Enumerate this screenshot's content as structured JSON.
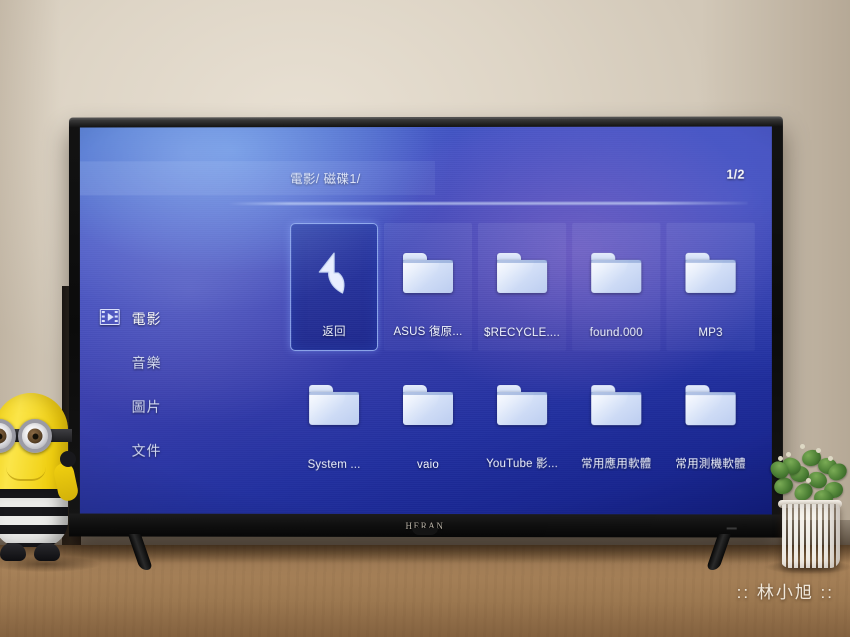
{
  "scene": {
    "watermark": ":: 林小旭 ::"
  },
  "tv": {
    "brand": "HERAN"
  },
  "ui": {
    "breadcrumb": "電影/ 磁碟1/",
    "page_indicator": "1/2",
    "accent_color": "#8ea8ee",
    "selected_tile_fill": "#1c2c96",
    "folder_icon_color": "#d6e2f8",
    "text_color": "#f0f4ff"
  },
  "sidebar": {
    "items": [
      {
        "label": "電影",
        "icon": "film-icon",
        "active": true
      },
      {
        "label": "音樂",
        "icon": "",
        "active": false
      },
      {
        "label": "圖片",
        "icon": "",
        "active": false
      },
      {
        "label": "文件",
        "icon": "",
        "active": false
      }
    ]
  },
  "grid": {
    "rows": [
      {
        "items": [
          {
            "label": "返回",
            "icon": "back-arrow-icon",
            "selected": true
          },
          {
            "label": "ASUS 復原...",
            "icon": "folder-icon",
            "selected": false
          },
          {
            "label": "$RECYCLE....",
            "icon": "folder-icon",
            "selected": false
          },
          {
            "label": "found.000",
            "icon": "folder-icon",
            "selected": false
          },
          {
            "label": "MP3",
            "icon": "folder-icon",
            "selected": false
          }
        ]
      },
      {
        "items": [
          {
            "label": "System ...",
            "icon": "folder-icon",
            "selected": false
          },
          {
            "label": "vaio",
            "icon": "folder-icon",
            "selected": false
          },
          {
            "label": "YouTube 影...",
            "icon": "folder-icon",
            "selected": false
          },
          {
            "label": "常用應用軟體",
            "icon": "folder-icon",
            "selected": false
          },
          {
            "label": "常用測機軟體",
            "icon": "folder-icon",
            "selected": false
          }
        ]
      }
    ]
  }
}
